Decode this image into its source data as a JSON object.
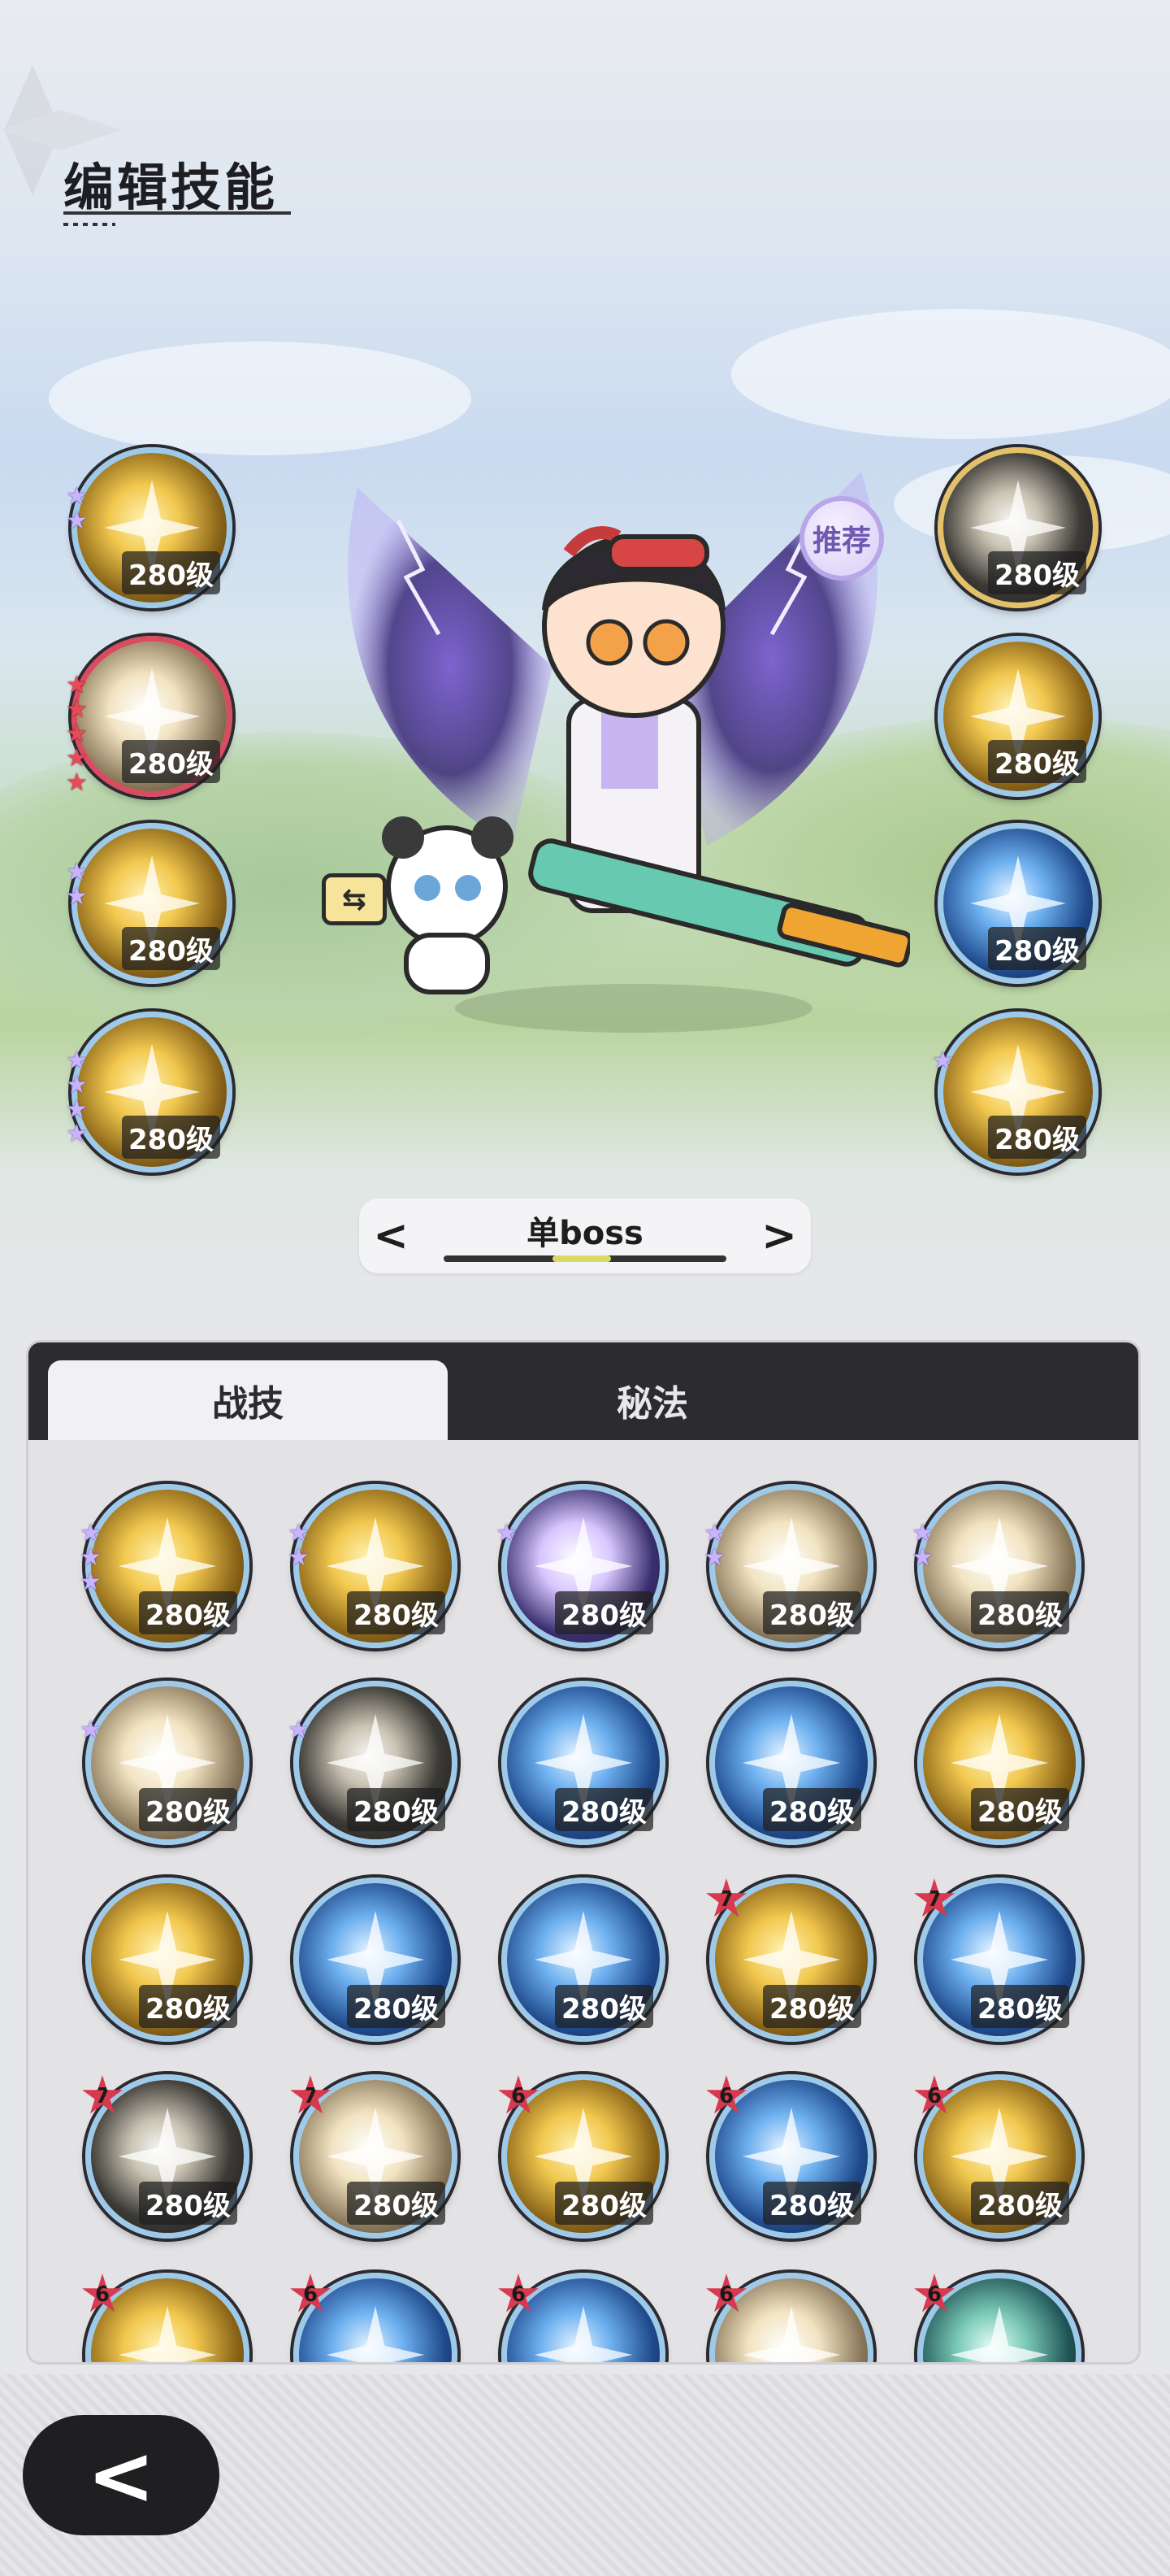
{
  "header": {
    "title": "编辑技能"
  },
  "scene": {
    "recommend_label": "推荐",
    "swap_icon": "swap-arrows-icon",
    "left_skills": [
      {
        "level": "280级",
        "art": "gold",
        "stars": 2,
        "star_color": "violet",
        "border": "blue"
      },
      {
        "level": "280级",
        "art": "cream",
        "stars": 5,
        "star_color": "red",
        "border": "red"
      },
      {
        "level": "280级",
        "art": "gold",
        "stars": 2,
        "star_color": "violet",
        "border": "blue"
      },
      {
        "level": "280级",
        "art": "gold",
        "stars": 4,
        "star_color": "violet",
        "border": "blue"
      }
    ],
    "right_skills": [
      {
        "level": "280级",
        "art": "dark",
        "stars": 0,
        "border": "gold"
      },
      {
        "level": "280级",
        "art": "gold",
        "stars": 0,
        "border": "blue"
      },
      {
        "level": "280级",
        "art": "blue",
        "stars": 0,
        "border": "blue"
      },
      {
        "level": "280级",
        "art": "gold",
        "stars": 1,
        "star_color": "violet",
        "border": "blue"
      }
    ]
  },
  "mode_selector": {
    "label": "单boss",
    "prev": "<",
    "next": ">"
  },
  "tabs": [
    {
      "label": "战技",
      "active": true
    },
    {
      "label": "秘法",
      "active": false
    }
  ],
  "skill_grid": [
    {
      "level": "280级",
      "art": "gold",
      "stars": 3,
      "rank": ""
    },
    {
      "level": "280级",
      "art": "gold",
      "stars": 2,
      "rank": ""
    },
    {
      "level": "280级",
      "art": "violet",
      "stars": 1,
      "rank": ""
    },
    {
      "level": "280级",
      "art": "cream",
      "stars": 2,
      "rank": ""
    },
    {
      "level": "280级",
      "art": "cream",
      "stars": 2,
      "rank": ""
    },
    {
      "level": "280级",
      "art": "cream",
      "stars": 1,
      "rank": ""
    },
    {
      "level": "280级",
      "art": "dark",
      "stars": 1,
      "rank": ""
    },
    {
      "level": "280级",
      "art": "blue",
      "stars": 0,
      "rank": ""
    },
    {
      "level": "280级",
      "art": "blue",
      "stars": 0,
      "rank": ""
    },
    {
      "level": "280级",
      "art": "gold",
      "stars": 0,
      "rank": ""
    },
    {
      "level": "280级",
      "art": "gold",
      "stars": 0,
      "rank": ""
    },
    {
      "level": "280级",
      "art": "blue",
      "stars": 0,
      "rank": ""
    },
    {
      "level": "280级",
      "art": "blue",
      "stars": 0,
      "rank": ""
    },
    {
      "level": "280级",
      "art": "gold",
      "stars": 0,
      "rank": "7"
    },
    {
      "level": "280级",
      "art": "blue",
      "stars": 0,
      "rank": "7"
    },
    {
      "level": "280级",
      "art": "dark",
      "stars": 0,
      "rank": "7"
    },
    {
      "level": "280级",
      "art": "cream",
      "stars": 0,
      "rank": "7"
    },
    {
      "level": "280级",
      "art": "gold",
      "stars": 0,
      "rank": "6"
    },
    {
      "level": "280级",
      "art": "blue",
      "stars": 0,
      "rank": "6"
    },
    {
      "level": "280级",
      "art": "gold",
      "stars": 0,
      "rank": "6"
    },
    {
      "level": "",
      "art": "gold",
      "stars": 0,
      "rank": "6"
    },
    {
      "level": "",
      "art": "blue",
      "stars": 0,
      "rank": "6"
    },
    {
      "level": "",
      "art": "blue",
      "stars": 0,
      "rank": "6"
    },
    {
      "level": "",
      "art": "cream",
      "stars": 0,
      "rank": "6"
    },
    {
      "level": "",
      "art": "teal",
      "stars": 0,
      "rank": "6"
    }
  ],
  "footer": {
    "back_icon": "chevron-left-icon",
    "back_label": "<"
  },
  "colors": {
    "border_blue": "#9fc9e8",
    "border_red": "#d94b5e",
    "border_gold": "#e3c06a",
    "star_violet": "#c9b3ff",
    "star_red": "#e84a5a",
    "tab_bar": "#2c2c2e"
  }
}
